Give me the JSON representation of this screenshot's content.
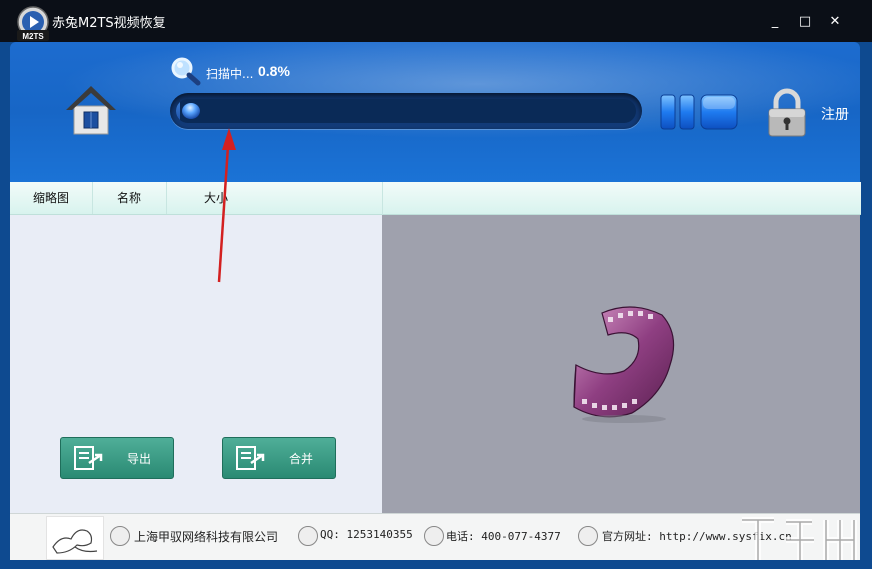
{
  "window": {
    "title": "赤兔M2TS视频恢复",
    "logo_text": "M2TS",
    "controls": {
      "minimize": "_",
      "maximize": "□",
      "close": "✕"
    }
  },
  "header": {
    "scan_label": "扫描中...",
    "scan_percent": "0.8%",
    "progress_fraction": 0.008,
    "register_label": "注册"
  },
  "table": {
    "columns": [
      "缩略图",
      "名称",
      "大小"
    ]
  },
  "buttons": {
    "export_label": "导出",
    "merge_label": "合并"
  },
  "footer": {
    "company": "上海甲驭网络科技有限公司",
    "qq": "QQ: 1253140355",
    "phone": "电话: 400-077-4377",
    "website": "官方网址: http://www.sysfix.cn"
  },
  "colors": {
    "header_blue": "#1766c6",
    "button_green": "#3a9b84",
    "annotation_red": "#d32020"
  },
  "icons": {
    "home": "home-icon",
    "scan": "magnifier-icon",
    "pause": "pause-icon",
    "stop": "stop-icon",
    "lock": "lock-icon",
    "film": "film-reel-icon"
  }
}
